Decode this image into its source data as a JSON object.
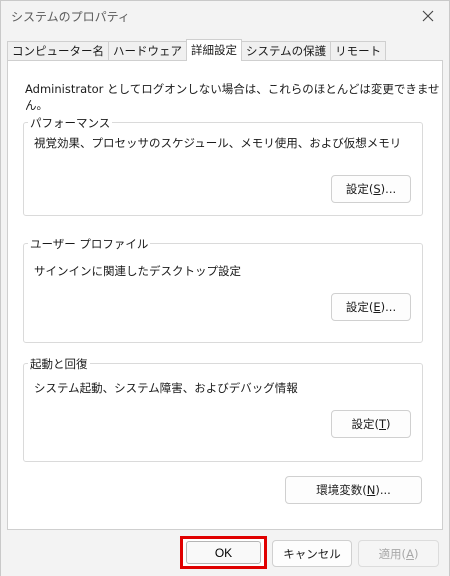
{
  "window": {
    "title": "システムのプロパティ"
  },
  "tabs": [
    {
      "label": "コンピューター名"
    },
    {
      "label": "ハードウェア"
    },
    {
      "label": "詳細設定",
      "active": true
    },
    {
      "label": "システムの保護"
    },
    {
      "label": "リモート"
    }
  ],
  "admin_note": "Administrator としてログオンしない場合は、これらのほとんどは変更できません。",
  "performance": {
    "legend": "パフォーマンス",
    "description": "視覚効果、プロセッサのスケジュール、メモリ使用、および仮想メモリ",
    "button": {
      "prefix": "設定(",
      "key": "S",
      "suffix": ")..."
    }
  },
  "user_profile": {
    "legend": "ユーザー プロファイル",
    "description": "サインインに関連したデスクトップ設定",
    "button": {
      "prefix": "設定(",
      "key": "E",
      "suffix": ")..."
    }
  },
  "startup_recovery": {
    "legend": "起動と回復",
    "description": "システム起動、システム障害、およびデバッグ情報",
    "button": {
      "prefix": "設定(",
      "key": "T",
      "suffix": ")"
    }
  },
  "env_vars_button": {
    "prefix": "環境変数(",
    "key": "N",
    "suffix": ")..."
  },
  "footer": {
    "ok": "OK",
    "cancel": "キャンセル",
    "apply": {
      "prefix": "適用(",
      "key": "A",
      "suffix": ")"
    }
  },
  "colors": {
    "highlight": "#e00000"
  }
}
